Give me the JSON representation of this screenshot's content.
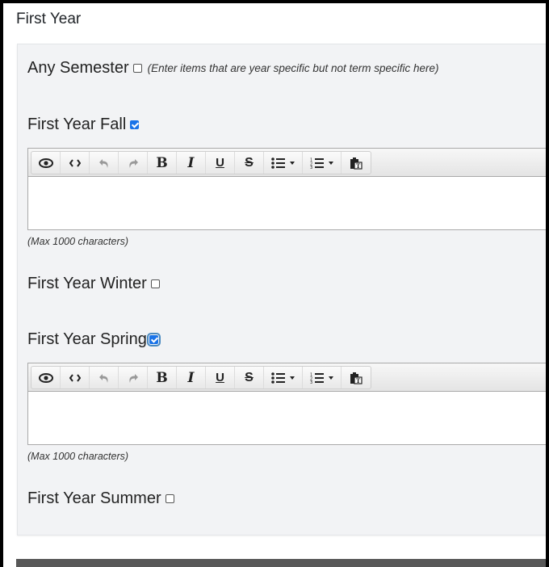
{
  "section": {
    "title": "First Year"
  },
  "terms": [
    {
      "label": "Any Semester",
      "checked": false,
      "hint": "(Enter items that are year specific but not term specific here)"
    },
    {
      "label": "First Year Fall",
      "checked": true
    },
    {
      "label": "First Year Winter",
      "checked": false
    },
    {
      "label": "First Year Spring",
      "checked": true,
      "focused": true
    },
    {
      "label": "First Year Summer",
      "checked": false
    }
  ],
  "editor": {
    "toolbar": [
      {
        "name": "preview",
        "icon": "eye-icon"
      },
      {
        "name": "code-view",
        "icon": "code-icon"
      },
      {
        "name": "undo",
        "icon": "undo-icon",
        "disabled": true
      },
      {
        "name": "redo",
        "icon": "redo-icon",
        "disabled": true
      },
      {
        "name": "bold",
        "icon": "bold-icon",
        "glyph": "B"
      },
      {
        "name": "italic",
        "icon": "italic-icon",
        "glyph": "I"
      },
      {
        "name": "underline",
        "icon": "underline-icon",
        "glyph": "U"
      },
      {
        "name": "strikethrough",
        "icon": "strikethrough-icon",
        "glyph": "S"
      },
      {
        "name": "bullet-list",
        "icon": "bullet-list-icon"
      },
      {
        "name": "numbered-list",
        "icon": "numbered-list-icon"
      },
      {
        "name": "paste",
        "icon": "paste-text-icon"
      }
    ],
    "fall_content": "",
    "spring_content": "",
    "max_note": "(Max 1000 characters)"
  }
}
